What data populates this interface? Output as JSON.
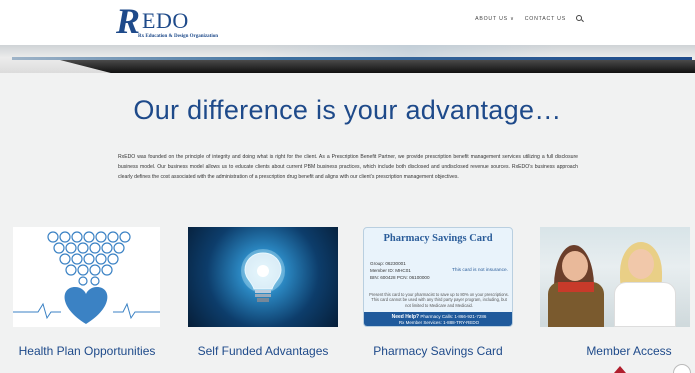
{
  "brand": {
    "logo_mark": "R",
    "logo_text": "EDO",
    "tagline": "Rx Education & Design Organization"
  },
  "nav": {
    "items": [
      "ABOUT US ∨",
      "CONTACT US"
    ],
    "search_icon": "search-icon"
  },
  "hero": {
    "title": "Our difference is your advantage…",
    "intro": "RxEDO was founded on the principle of integrity and doing what is right for the client. As a Prescription Benefit Partner, we provide prescription benefit management services utilizing a full disclosure business model. Our business model allows us to educate clients about current PBM business practices, which include both disclosed and undisclosed revenue sources. RxEDO’s business approach clearly defines the cost associated with the administration of a prescription drug benefit and aligns with our client’s prescription management objectives."
  },
  "cards": [
    {
      "title": "Health Plan Opportunities"
    },
    {
      "title": "Self Funded Advantages"
    },
    {
      "title": "Pharmacy Savings Card"
    },
    {
      "title": "Member Access"
    }
  ],
  "pharmacy_card": {
    "heading": "Pharmacy Savings Card",
    "group": "Group:        06230001",
    "member": "Member ID:   MHC01",
    "bin_pcn": "BIN: 600428   PCN: 06100000",
    "notice": "This card is not insurance.",
    "body": "Present this card to your pharmacist to save up to 80% on your prescriptions. This card cannot be used with any third party payer program, including, but not limited to Medicare and Medicaid.",
    "help": "Need Help?",
    "pharmacy_calls": "Pharmacy Calls: 1-866-921-7286",
    "member_services": "Rx Member Services: 1-888-TRY-REDO"
  },
  "colors": {
    "brand_blue": "#1e4a8a",
    "page_bg": "#f1f2f2"
  }
}
